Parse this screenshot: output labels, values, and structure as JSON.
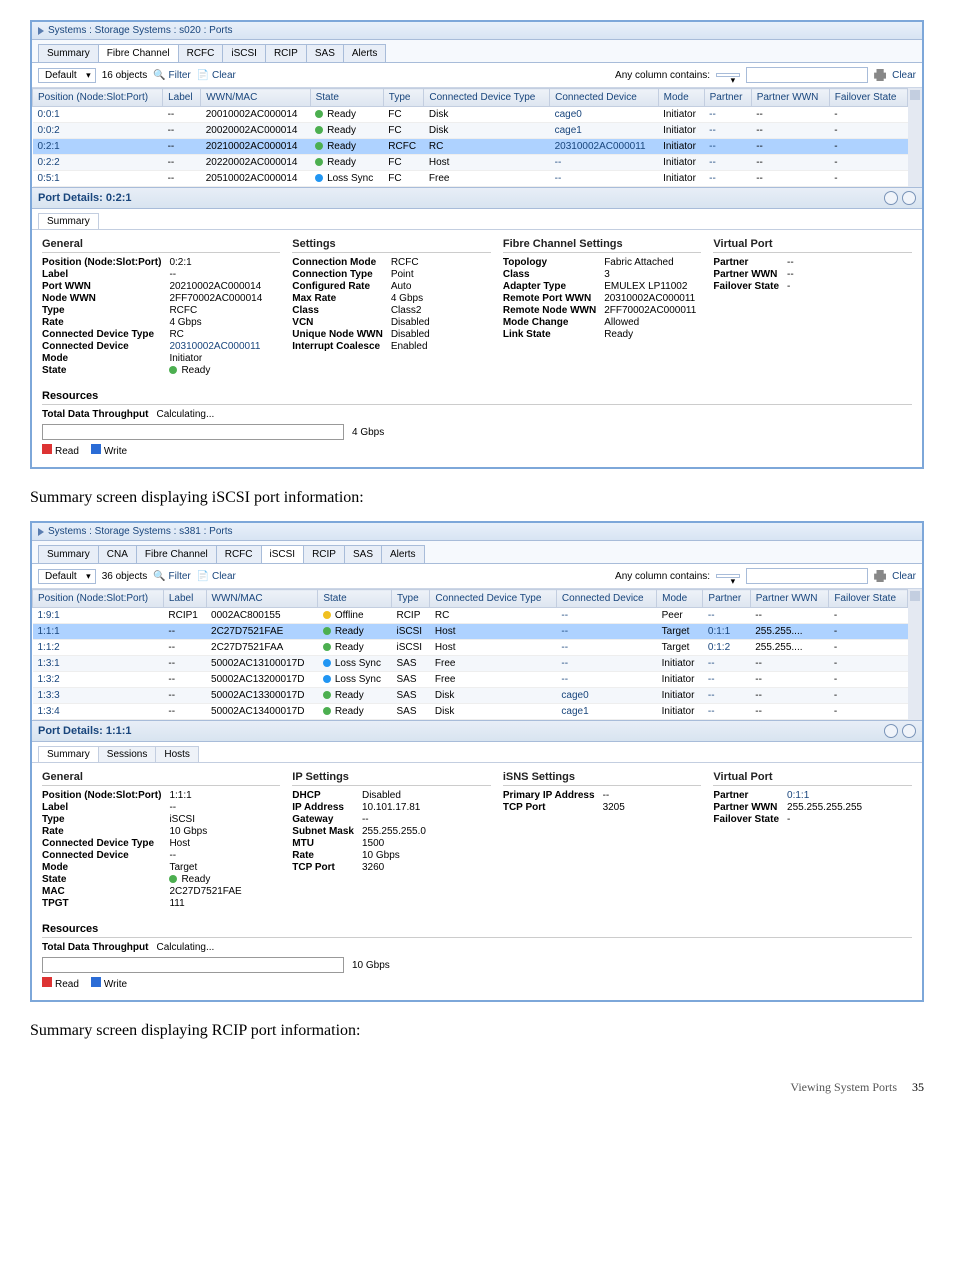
{
  "screenshot1": {
    "title": "Systems : Storage Systems : s020 : Ports",
    "tabs": [
      "Summary",
      "Fibre Channel",
      "RCFC",
      "iSCSI",
      "RCIP",
      "SAS",
      "Alerts"
    ],
    "active_tab": 1,
    "toolbar": {
      "view": "Default",
      "count": "16 objects",
      "filter": "Filter",
      "clear": "Clear",
      "anycol": "Any column contains:",
      "clear2": "Clear"
    },
    "columns": [
      "Position (Node:Slot:Port)",
      "Label",
      "WWN/MAC",
      "State",
      "Type",
      "Connected Device Type",
      "Connected Device",
      "Mode",
      "Partner",
      "Partner WWN",
      "Failover State"
    ],
    "rows": [
      {
        "pos": "0:0:1",
        "label": "--",
        "wwn": "20010002AC000014",
        "dot": "green",
        "state": "Ready",
        "type": "FC",
        "cdt": "Disk",
        "cd": "cage0",
        "mode": "Initiator",
        "partner": "--",
        "pwwn": "--",
        "fo": "-"
      },
      {
        "pos": "0:0:2",
        "label": "--",
        "wwn": "20020002AC000014",
        "dot": "green",
        "state": "Ready",
        "type": "FC",
        "cdt": "Disk",
        "cd": "cage1",
        "mode": "Initiator",
        "partner": "--",
        "pwwn": "--",
        "fo": "-"
      },
      {
        "pos": "0:2:1",
        "label": "--",
        "wwn": "20210002AC000014",
        "dot": "green",
        "state": "Ready",
        "type": "RCFC",
        "cdt": "RC",
        "cd": "20310002AC000011",
        "mode": "Initiator",
        "partner": "--",
        "pwwn": "--",
        "fo": "-",
        "hl": true
      },
      {
        "pos": "0:2:2",
        "label": "--",
        "wwn": "20220002AC000014",
        "dot": "green",
        "state": "Ready",
        "type": "FC",
        "cdt": "Host",
        "cd": "--",
        "mode": "Initiator",
        "partner": "--",
        "pwwn": "--",
        "fo": "-"
      },
      {
        "pos": "0:5:1",
        "label": "--",
        "wwn": "20510002AC000014",
        "dot": "blue",
        "state": "Loss Sync",
        "type": "FC",
        "cdt": "Free",
        "cd": "--",
        "mode": "Initiator",
        "partner": "--",
        "pwwn": "--",
        "fo": "-"
      }
    ],
    "port_details": "Port Details: 0:2:1",
    "subtabs": [
      "Summary"
    ],
    "general_h": "General",
    "settings_h": "Settings",
    "fc_h": "Fibre Channel Settings",
    "vp_h": "Virtual Port",
    "general": {
      "Position (Node:Slot:Port)": "0:2:1",
      "Label": "--",
      "Port WWN": "20210002AC000014",
      "Node WWN": "2FF70002AC000014",
      "Type": "RCFC",
      "Rate": "4 Gbps",
      "Connected Device Type": "RC",
      "Connected Device": "20310002AC000011",
      "Mode": "Initiator",
      "State": "● Ready"
    },
    "settings": {
      "Connection Mode": "RCFC",
      "Connection Type": "Point",
      "Configured Rate": "Auto",
      "Max Rate": "4 Gbps",
      "Class": "Class2",
      "VCN": "Disabled",
      "Unique Node WWN": "Disabled",
      "Interrupt Coalesce": "Enabled"
    },
    "fc": {
      "Topology": "Fabric Attached",
      "Class": "3",
      "Adapter Type": "EMULEX LP11002",
      "Remote Port WWN": "20310002AC000011",
      "Remote Node WWN": "2FF70002AC000011",
      "Mode Change": "Allowed",
      "Link State": "Ready"
    },
    "vp": {
      "Partner": "--",
      "Partner WWN": "--",
      "Failover State": "-"
    },
    "resources_h": "Resources",
    "throughput_label": "Total Data Throughput",
    "throughput_val": "Calculating...",
    "throughput_cap": "4 Gbps",
    "legend_read": "Read",
    "legend_write": "Write"
  },
  "caption1": "Summary screen displaying iSCSI port information:",
  "screenshot2": {
    "title": "Systems : Storage Systems : s381 : Ports",
    "tabs": [
      "Summary",
      "CNA",
      "Fibre Channel",
      "RCFC",
      "iSCSI",
      "RCIP",
      "SAS",
      "Alerts"
    ],
    "active_tab": 4,
    "toolbar": {
      "view": "Default",
      "count": "36 objects",
      "filter": "Filter",
      "clear": "Clear",
      "anycol": "Any column contains:",
      "clear2": "Clear"
    },
    "columns": [
      "Position (Node:Slot:Port)",
      "Label",
      "WWN/MAC",
      "State",
      "Type",
      "Connected Device Type",
      "Connected Device",
      "Mode",
      "Partner",
      "Partner WWN",
      "Failover State"
    ],
    "rows": [
      {
        "pos": "1:9:1",
        "label": "RCIP1",
        "wwn": "0002AC800155",
        "dot": "yellow",
        "state": "Offline",
        "type": "RCIP",
        "cdt": "RC",
        "cd": "--",
        "mode": "Peer",
        "partner": "--",
        "pwwn": "--",
        "fo": "-"
      },
      {
        "pos": "1:1:1",
        "label": "--",
        "wwn": "2C27D7521FAE",
        "dot": "green",
        "state": "Ready",
        "type": "iSCSI",
        "cdt": "Host",
        "cd": "--",
        "mode": "Target",
        "partner": "0:1:1",
        "pwwn": "255.255....",
        "fo": "-",
        "hl": true
      },
      {
        "pos": "1:1:2",
        "label": "--",
        "wwn": "2C27D7521FAA",
        "dot": "green",
        "state": "Ready",
        "type": "iSCSI",
        "cdt": "Host",
        "cd": "--",
        "mode": "Target",
        "partner": "0:1:2",
        "pwwn": "255.255....",
        "fo": "-"
      },
      {
        "pos": "1:3:1",
        "label": "--",
        "wwn": "50002AC13100017D",
        "dot": "blue",
        "state": "Loss Sync",
        "type": "SAS",
        "cdt": "Free",
        "cd": "--",
        "mode": "Initiator",
        "partner": "--",
        "pwwn": "--",
        "fo": "-"
      },
      {
        "pos": "1:3:2",
        "label": "--",
        "wwn": "50002AC13200017D",
        "dot": "blue",
        "state": "Loss Sync",
        "type": "SAS",
        "cdt": "Free",
        "cd": "--",
        "mode": "Initiator",
        "partner": "--",
        "pwwn": "--",
        "fo": "-"
      },
      {
        "pos": "1:3:3",
        "label": "--",
        "wwn": "50002AC13300017D",
        "dot": "green",
        "state": "Ready",
        "type": "SAS",
        "cdt": "Disk",
        "cd": "cage0",
        "mode": "Initiator",
        "partner": "--",
        "pwwn": "--",
        "fo": "-"
      },
      {
        "pos": "1:3:4",
        "label": "--",
        "wwn": "50002AC13400017D",
        "dot": "green",
        "state": "Ready",
        "type": "SAS",
        "cdt": "Disk",
        "cd": "cage1",
        "mode": "Initiator",
        "partner": "--",
        "pwwn": "--",
        "fo": "-"
      }
    ],
    "port_details": "Port Details: 1:1:1",
    "subtabs": [
      "Summary",
      "Sessions",
      "Hosts"
    ],
    "general_h": "General",
    "ip_h": "IP Settings",
    "isns_h": "iSNS Settings",
    "vp_h": "Virtual Port",
    "general": {
      "Position (Node:Slot:Port)": "1:1:1",
      "Label": "--",
      "Type": "iSCSI",
      "Rate": "10 Gbps",
      "Connected Device Type": "Host",
      "Connected Device": "--",
      "Mode": "Target",
      "State": "● Ready",
      "MAC": "2C27D7521FAE",
      "TPGT": "111"
    },
    "ip": {
      "DHCP": "Disabled",
      "IP Address": "10.101.17.81",
      "Gateway": "--",
      "Subnet Mask": "255.255.255.0",
      "MTU": "1500",
      "Rate": "10 Gbps",
      "TCP Port": "3260"
    },
    "isns": {
      "Primary IP Address": "--",
      "TCP Port": "3205"
    },
    "vp": {
      "Partner": "0:1:1",
      "Partner WWN": "255.255.255.255",
      "Failover State": "-"
    },
    "resources_h": "Resources",
    "throughput_label": "Total Data Throughput",
    "throughput_val": "Calculating...",
    "throughput_cap": "10 Gbps",
    "legend_read": "Read",
    "legend_write": "Write"
  },
  "caption2": "Summary screen displaying RCIP port information:",
  "footer": {
    "section": "Viewing System Ports",
    "page": "35"
  }
}
